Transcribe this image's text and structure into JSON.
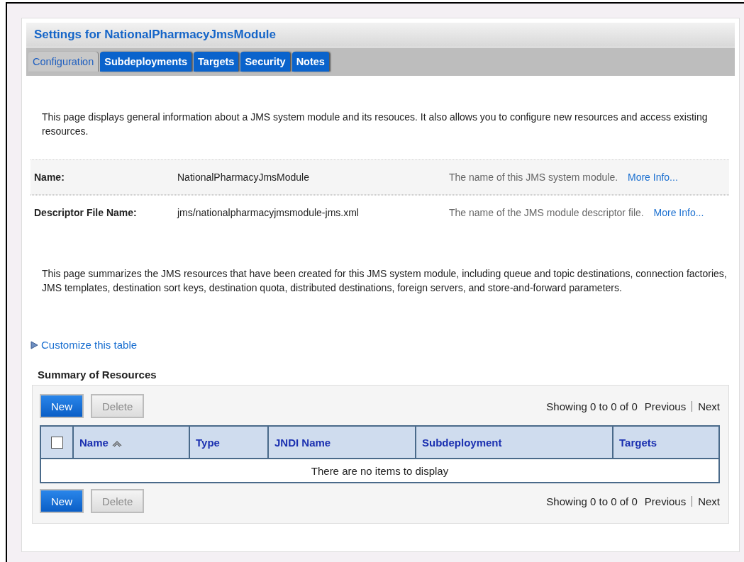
{
  "header": {
    "title": "Settings for NationalPharmacyJmsModule"
  },
  "tabs": [
    {
      "label": "Configuration",
      "selected": true
    },
    {
      "label": "Subdeployments",
      "selected": false
    },
    {
      "label": "Targets",
      "selected": false
    },
    {
      "label": "Security",
      "selected": false
    },
    {
      "label": "Notes",
      "selected": false
    }
  ],
  "intro": "This page displays general information about a JMS system module and its resouces. It also allows you to configure new resources and access existing resources.",
  "fields": [
    {
      "label": "Name:",
      "value": "NationalPharmacyJmsModule",
      "help": "The name of this JMS system module.",
      "link": "More Info..."
    },
    {
      "label": "Descriptor File Name:",
      "value": "jms/nationalpharmacyjmsmodule-jms.xml",
      "help": "The name of the JMS module descriptor file.",
      "link": "More Info..."
    }
  ],
  "summary_text": "This page summarizes the JMS resources that have been created for this JMS system module, including queue and topic destinations, connection factories, JMS templates, destination sort keys, destination quota, distributed destinations, foreign servers, and store-and-forward parameters.",
  "customize_link": "Customize this table",
  "table_section": {
    "title": "Summary of Resources",
    "toolbars": [
      {
        "buttons": [
          {
            "label": "New",
            "disabled": false
          },
          {
            "label": "Delete",
            "disabled": true
          }
        ],
        "showing": "Showing 0 to 0 of 0",
        "previous": "Previous",
        "next": "Next"
      },
      {
        "buttons": [
          {
            "label": "New",
            "disabled": false
          },
          {
            "label": "Delete",
            "disabled": true
          }
        ],
        "showing": "Showing 0 to 0 of 0",
        "previous": "Previous",
        "next": "Next"
      }
    ],
    "select_all": {
      "checked": false
    },
    "columns": [
      {
        "label": "Name",
        "sorted": true
      },
      {
        "label": "Type",
        "sorted": false
      },
      {
        "label": "JNDI Name",
        "sorted": false
      },
      {
        "label": "Subdeployment",
        "sorted": false
      },
      {
        "label": "Targets",
        "sorted": false
      }
    ],
    "empty_message": "There are no items to display"
  }
}
